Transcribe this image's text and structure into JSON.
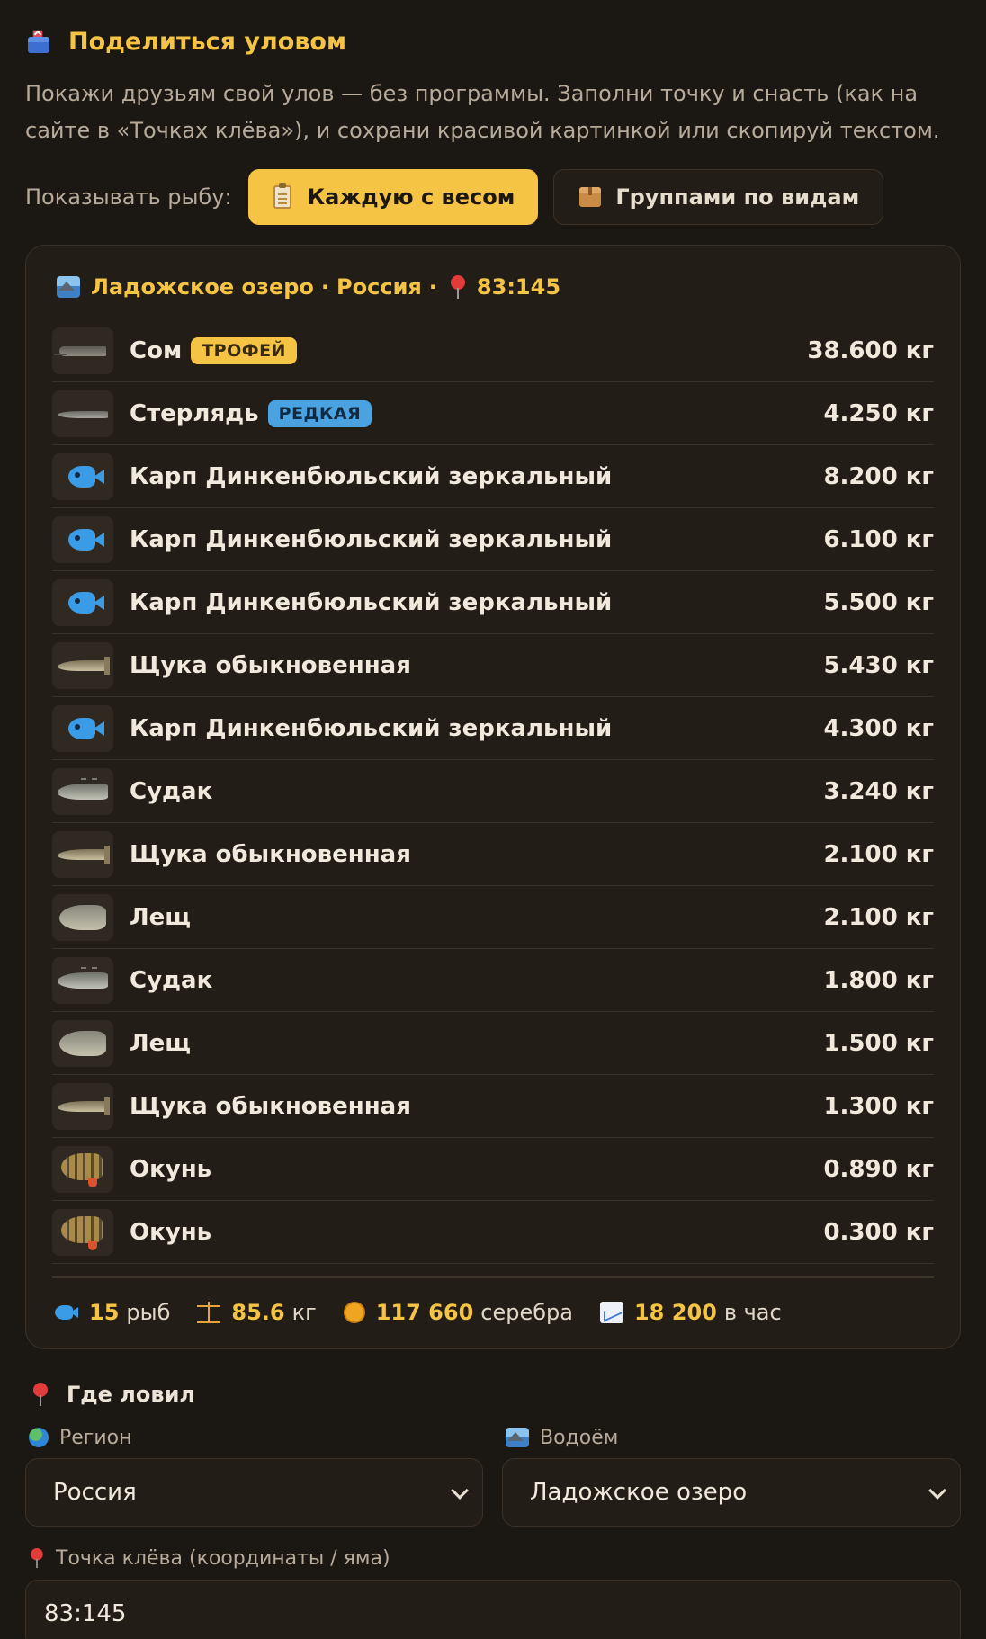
{
  "header": {
    "icon": "outbox-tray-icon",
    "title": "Поделиться уловом"
  },
  "description": "Покажи друзьям свой улов — без программы. Заполни точку и снасть (как на сайте в «Точках клёва»), и сохрани красивой картинкой или скопируй текстом.",
  "display_toggle": {
    "label": "Показывать рыбу:",
    "options": [
      {
        "label": "Каждую с весом",
        "icon": "clipboard-icon",
        "active": true
      },
      {
        "label": "Группами по видам",
        "icon": "package-icon",
        "active": false
      }
    ]
  },
  "catch_card": {
    "location": {
      "water": "Ладожское озеро",
      "separator1": "·",
      "region": "Россия",
      "separator2": "·",
      "coords": "83:145"
    },
    "fish": [
      {
        "name": "Сом",
        "badge": "ТРОФЕЙ",
        "badge_type": "trophy",
        "weight": "38.600 кг",
        "thumb": "catfish-image"
      },
      {
        "name": "Стерлядь",
        "badge": "РЕДКАЯ",
        "badge_type": "rare",
        "weight": "4.250 кг",
        "thumb": "sterlet-image"
      },
      {
        "name": "Карп Динкенбюльский зеркальный",
        "badge": "",
        "weight": "8.200 кг",
        "thumb": "fish-icon"
      },
      {
        "name": "Карп Динкенбюльский зеркальный",
        "badge": "",
        "weight": "6.100 кг",
        "thumb": "fish-icon"
      },
      {
        "name": "Карп Динкенбюльский зеркальный",
        "badge": "",
        "weight": "5.500 кг",
        "thumb": "fish-icon"
      },
      {
        "name": "Щука обыкновенная",
        "badge": "",
        "weight": "5.430 кг",
        "thumb": "pike-image"
      },
      {
        "name": "Карп Динкенбюльский зеркальный",
        "badge": "",
        "weight": "4.300 кг",
        "thumb": "fish-icon"
      },
      {
        "name": "Судак",
        "badge": "",
        "weight": "3.240 кг",
        "thumb": "zander-image"
      },
      {
        "name": "Щука обыкновенная",
        "badge": "",
        "weight": "2.100 кг",
        "thumb": "pike-image"
      },
      {
        "name": "Лещ",
        "badge": "",
        "weight": "2.100 кг",
        "thumb": "bream-image"
      },
      {
        "name": "Судак",
        "badge": "",
        "weight": "1.800 кг",
        "thumb": "zander-image"
      },
      {
        "name": "Лещ",
        "badge": "",
        "weight": "1.500 кг",
        "thumb": "bream-image"
      },
      {
        "name": "Щука обыкновенная",
        "badge": "",
        "weight": "1.300 кг",
        "thumb": "pike-image"
      },
      {
        "name": "Окунь",
        "badge": "",
        "weight": "0.890 кг",
        "thumb": "perch-image"
      },
      {
        "name": "Окунь",
        "badge": "",
        "weight": "0.300 кг",
        "thumb": "perch-image"
      }
    ],
    "stats": {
      "count": "15",
      "count_unit": "рыб",
      "weight": "85.6",
      "weight_unit": "кг",
      "silver": "117 660",
      "silver_unit": "серебра",
      "rate": "18 200",
      "rate_unit": "в час"
    }
  },
  "where_caught": {
    "title": "Где ловил",
    "region_label": "Регион",
    "region_value": "Россия",
    "water_label": "Водоём",
    "water_value": "Ладожское озеро",
    "spot_label": "Точка клёва (координаты / яма)",
    "spot_value": "83:145"
  },
  "colors": {
    "background": "#1b1713",
    "accent": "#f5c444",
    "card": "#221d17",
    "rare_badge": "#4aa3e0"
  }
}
